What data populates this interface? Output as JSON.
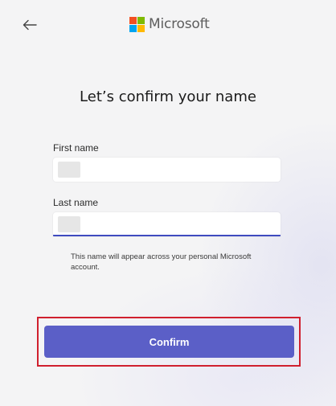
{
  "header": {
    "back_icon": "arrow-left-icon",
    "logo_text": "Microsoft",
    "logo_colors": [
      "#f25022",
      "#7fba00",
      "#00a4ef",
      "#ffb900"
    ]
  },
  "page": {
    "title": "Let’s confirm your name"
  },
  "form": {
    "first_name_label": "First name",
    "first_name_value": "",
    "last_name_label": "Last name",
    "last_name_value": "",
    "helper_text": "This name will appear across your personal Microsoft account."
  },
  "actions": {
    "confirm_label": "Confirm",
    "confirm_color": "#5b5fc7",
    "highlight_color": "#d0202e"
  }
}
